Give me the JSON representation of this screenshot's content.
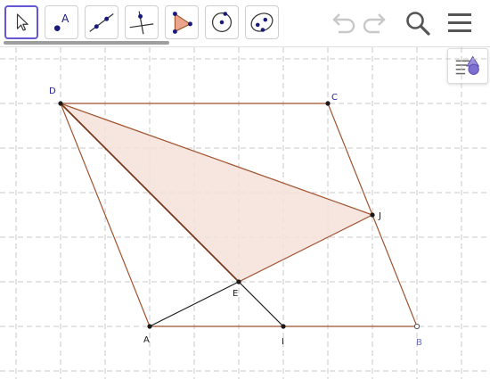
{
  "toolbar": {
    "tools": [
      {
        "name": "move-tool",
        "selected": true
      },
      {
        "name": "point-tool",
        "label": "A"
      },
      {
        "name": "line-tool"
      },
      {
        "name": "perpendicular-line-tool"
      },
      {
        "name": "polygon-tool"
      },
      {
        "name": "circle-center-point-tool"
      },
      {
        "name": "ellipse-tool"
      }
    ],
    "actions": [
      "undo-icon",
      "redo-icon",
      "search-icon",
      "menu-icon"
    ]
  },
  "colors": {
    "accent": "#6557d2",
    "polygon_stroke": "#a0522d",
    "polygon_fill": "#f6e2d9",
    "segment_dark": "#1a1a1a",
    "point_blue_label": "#1f1fa8",
    "point_b_label": "#6f6fb8",
    "grid": "#c8c8c8"
  },
  "points": {
    "D": {
      "label": "D"
    },
    "C": {
      "label": "C"
    },
    "J": {
      "label": "J"
    },
    "E": {
      "label": "E"
    },
    "A": {
      "label": "A"
    },
    "I": {
      "label": "I"
    },
    "B": {
      "label": "B"
    }
  }
}
